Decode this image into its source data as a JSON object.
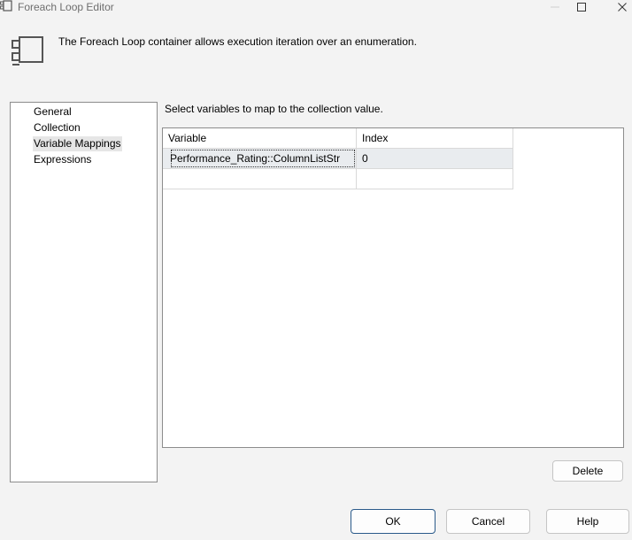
{
  "window": {
    "title": "Foreach Loop Editor",
    "controls": [
      "minimize",
      "maximize",
      "close"
    ]
  },
  "header": {
    "icon": "foreach-loop-icon",
    "description": "The Foreach Loop container allows execution iteration over an enumeration."
  },
  "nav": {
    "items": [
      {
        "label": "General",
        "selected": false
      },
      {
        "label": "Collection",
        "selected": false
      },
      {
        "label": "Variable Mappings",
        "selected": true
      },
      {
        "label": "Expressions",
        "selected": false
      }
    ]
  },
  "main": {
    "instruction": "Select variables to map to the collection value.",
    "grid": {
      "columns": [
        "Variable",
        "Index"
      ],
      "rows": [
        [
          "Performance_Rating::ColumnListStr",
          "0"
        ],
        [
          "",
          ""
        ]
      ]
    },
    "delete_label": "Delete"
  },
  "footer": {
    "ok_label": "OK",
    "cancel_label": "Cancel",
    "help_label": "Help"
  }
}
